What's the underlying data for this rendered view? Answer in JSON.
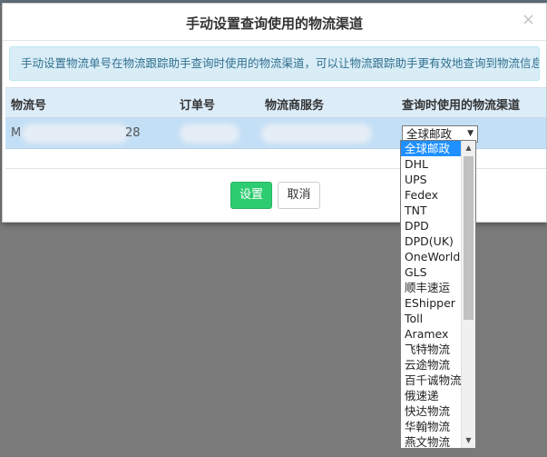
{
  "dialog": {
    "title": "手动设置查询使用的物流渠道",
    "close_glyph": "×",
    "info": "手动设置物流单号在物流跟踪助手查询时使用的物流渠道，可以让物流跟踪助手更有效地查询到物流信息\""
  },
  "table": {
    "headers": [
      "物流号",
      "订单号",
      "物流商服务",
      "查询时使用的物流渠道"
    ],
    "row": {
      "tracking_prefix": "M",
      "tracking_suffix": "28",
      "order_prefix": "",
      "selected_channel": "全球邮政"
    }
  },
  "buttons": {
    "set_label": "设置",
    "cancel_label": "取消"
  },
  "dropdown": {
    "options": [
      "全球邮政",
      "DHL",
      "UPS",
      "Fedex",
      "TNT",
      "DPD",
      "DPD(UK)",
      "OneWorld",
      "GLS",
      "顺丰速运",
      "EShipper",
      "Toll",
      "Aramex",
      "飞特物流",
      "云途物流",
      "百千诚物流",
      "俄速递",
      "快达物流",
      "华翰物流",
      "燕文物流"
    ],
    "selected_index": 0,
    "arrow_glyph": "▼",
    "scroll_up_glyph": "▲",
    "scroll_down_glyph": "▼"
  }
}
